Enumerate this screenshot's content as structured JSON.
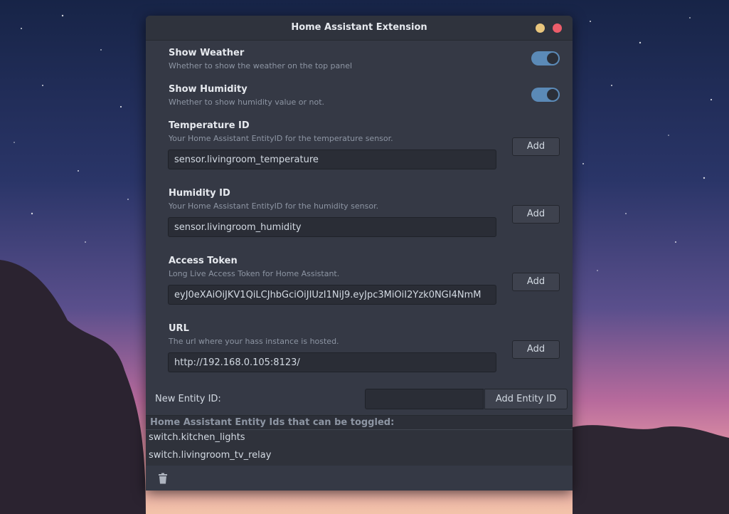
{
  "window": {
    "title": "Home Assistant Extension"
  },
  "settings": {
    "show_weather": {
      "title": "Show Weather",
      "description": "Whether to show the weather on the top panel",
      "enabled": true
    },
    "show_humidity": {
      "title": "Show Humidity",
      "description": "Whether to show humidity value or not.",
      "enabled": true
    },
    "temperature_id": {
      "title": "Temperature ID",
      "description": "Your Home Assistant EntityID for the temperature sensor.",
      "value": "sensor.livingroom_temperature",
      "button": "Add"
    },
    "humidity_id": {
      "title": "Humidity ID",
      "description": "Your Home Assistant EntityID for the humidity sensor.",
      "value": "sensor.livingroom_humidity",
      "button": "Add"
    },
    "access_token": {
      "title": "Access Token",
      "description": "Long Live Access Token for Home Assistant.",
      "value": "eyJ0eXAiOiJKV1QiLCJhbGciOiJIUzI1NiJ9.eyJpc3MiOiI2Yzk0NGI4NmM",
      "button": "Add"
    },
    "url": {
      "title": "URL",
      "description": "The url where your hass instance is hosted.",
      "value": "http://192.168.0.105:8123/",
      "button": "Add"
    }
  },
  "new_entity": {
    "label": "New Entity ID:",
    "value": "",
    "button": "Add Entity ID"
  },
  "entity_list": {
    "header": "Home Assistant Entity Ids that can be toggled:",
    "items": [
      "switch.kitchen_lights",
      "switch.livingroom_tv_relay"
    ]
  },
  "icons": {
    "delete": "trash-icon",
    "minimize": "minimize-icon",
    "close": "close-icon"
  },
  "colors": {
    "accent": "#5b8ab7",
    "background": "#353945",
    "close": "#ec5d6a",
    "minimize": "#e9c67d"
  }
}
